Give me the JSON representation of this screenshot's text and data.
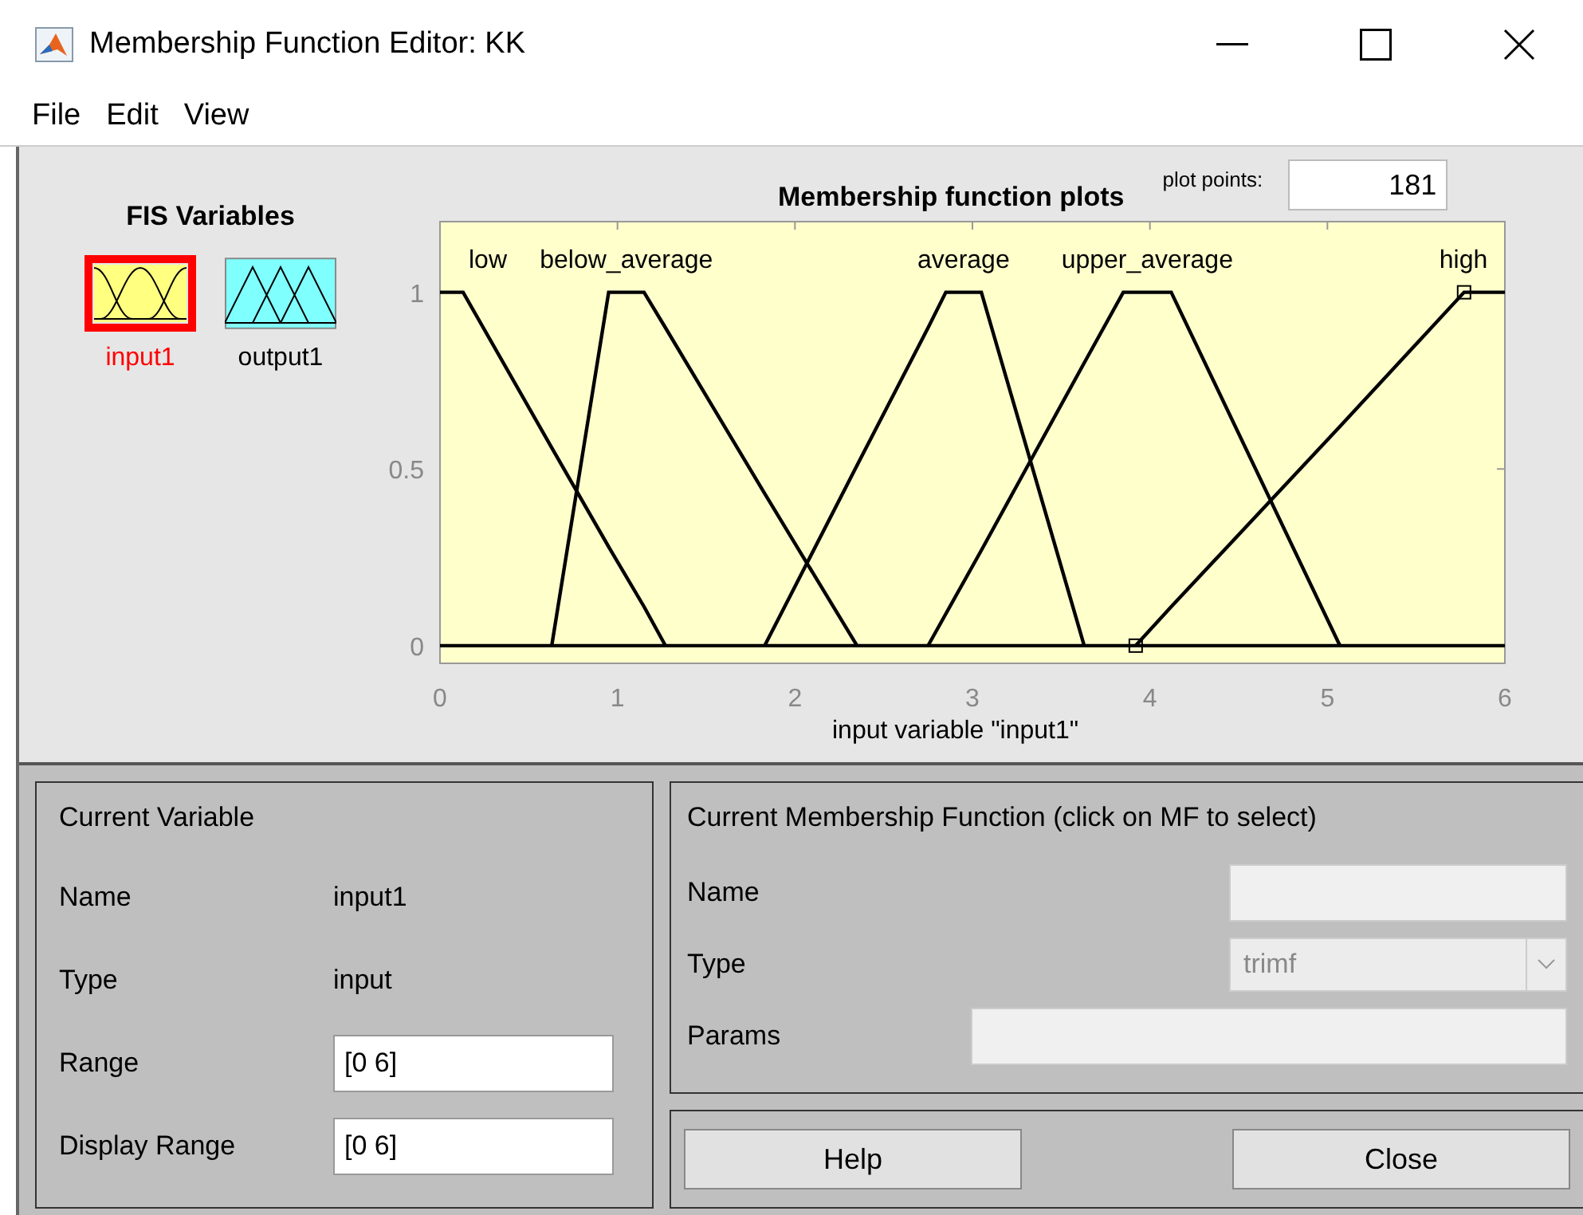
{
  "window": {
    "title": "Membership Function Editor: KK"
  },
  "menu": [
    "File",
    "Edit",
    "View"
  ],
  "fis_variables": {
    "title": "FIS Variables",
    "items": [
      {
        "label": "input1",
        "kind": "input",
        "selected": true
      },
      {
        "label": "output1",
        "kind": "output",
        "selected": false
      }
    ]
  },
  "plot": {
    "plot_points_label": "plot points:",
    "plot_points": "181",
    "chart_data": {
      "type": "line",
      "title": "Membership function plots",
      "xlabel": "input variable \"input1\"",
      "x": [
        0,
        0.13,
        0.63,
        0.95,
        1.15,
        1.27,
        1.83,
        2.35,
        2.75,
        2.85,
        3.05,
        3.63,
        3.85,
        3.92,
        4.12,
        5.07,
        5.77,
        6
      ],
      "xlim": [
        0,
        6
      ],
      "ylim": [
        -0.05,
        1.2
      ],
      "xticks": [
        0,
        1,
        2,
        3,
        4,
        5,
        6
      ],
      "yticks": [
        0,
        0.5,
        1
      ],
      "series": [
        {
          "name": "low",
          "color": "#000000",
          "values": [
            1,
            1,
            0.56,
            0.28,
            0.11,
            0,
            null,
            null,
            null,
            null,
            null,
            null,
            null,
            null,
            null,
            null,
            null,
            null
          ]
        },
        {
          "name": "below_average",
          "color": "#000000",
          "values": [
            null,
            null,
            0,
            1,
            1,
            0.9,
            0.43,
            0,
            null,
            null,
            null,
            null,
            null,
            null,
            null,
            null,
            null,
            null
          ]
        },
        {
          "name": "average",
          "color": "#000000",
          "values": [
            null,
            null,
            null,
            null,
            null,
            null,
            0,
            0.51,
            0.9,
            1,
            1,
            0,
            null,
            null,
            null,
            null,
            null,
            null
          ]
        },
        {
          "name": "upper_average",
          "color": "#000000",
          "values": [
            null,
            null,
            null,
            null,
            null,
            null,
            null,
            null,
            0,
            0.09,
            0.27,
            0.8,
            1,
            1,
            1,
            0,
            null,
            null
          ]
        },
        {
          "name": "high",
          "color": "#000000",
          "values": [
            null,
            null,
            null,
            null,
            null,
            null,
            null,
            null,
            null,
            null,
            null,
            null,
            null,
            0,
            0.11,
            0.62,
            1,
            1
          ]
        }
      ]
    }
  },
  "current_variable": {
    "title": "Current Variable",
    "rows": [
      {
        "kind": "text",
        "label": "Name",
        "value": "input1"
      },
      {
        "kind": "text",
        "label": "Type",
        "value": "input"
      },
      {
        "kind": "field",
        "label": "Range",
        "value": "[0 6]"
      },
      {
        "kind": "field",
        "label": "Display Range",
        "value": "[0 6]"
      }
    ]
  },
  "current_mf": {
    "title": "Current Membership Function (click on MF to select)",
    "name_label": "Name",
    "type_label": "Type",
    "type_value": "trimf",
    "params_label": "Params",
    "disabled": true
  },
  "buttons": [
    "Help",
    "Close"
  ]
}
